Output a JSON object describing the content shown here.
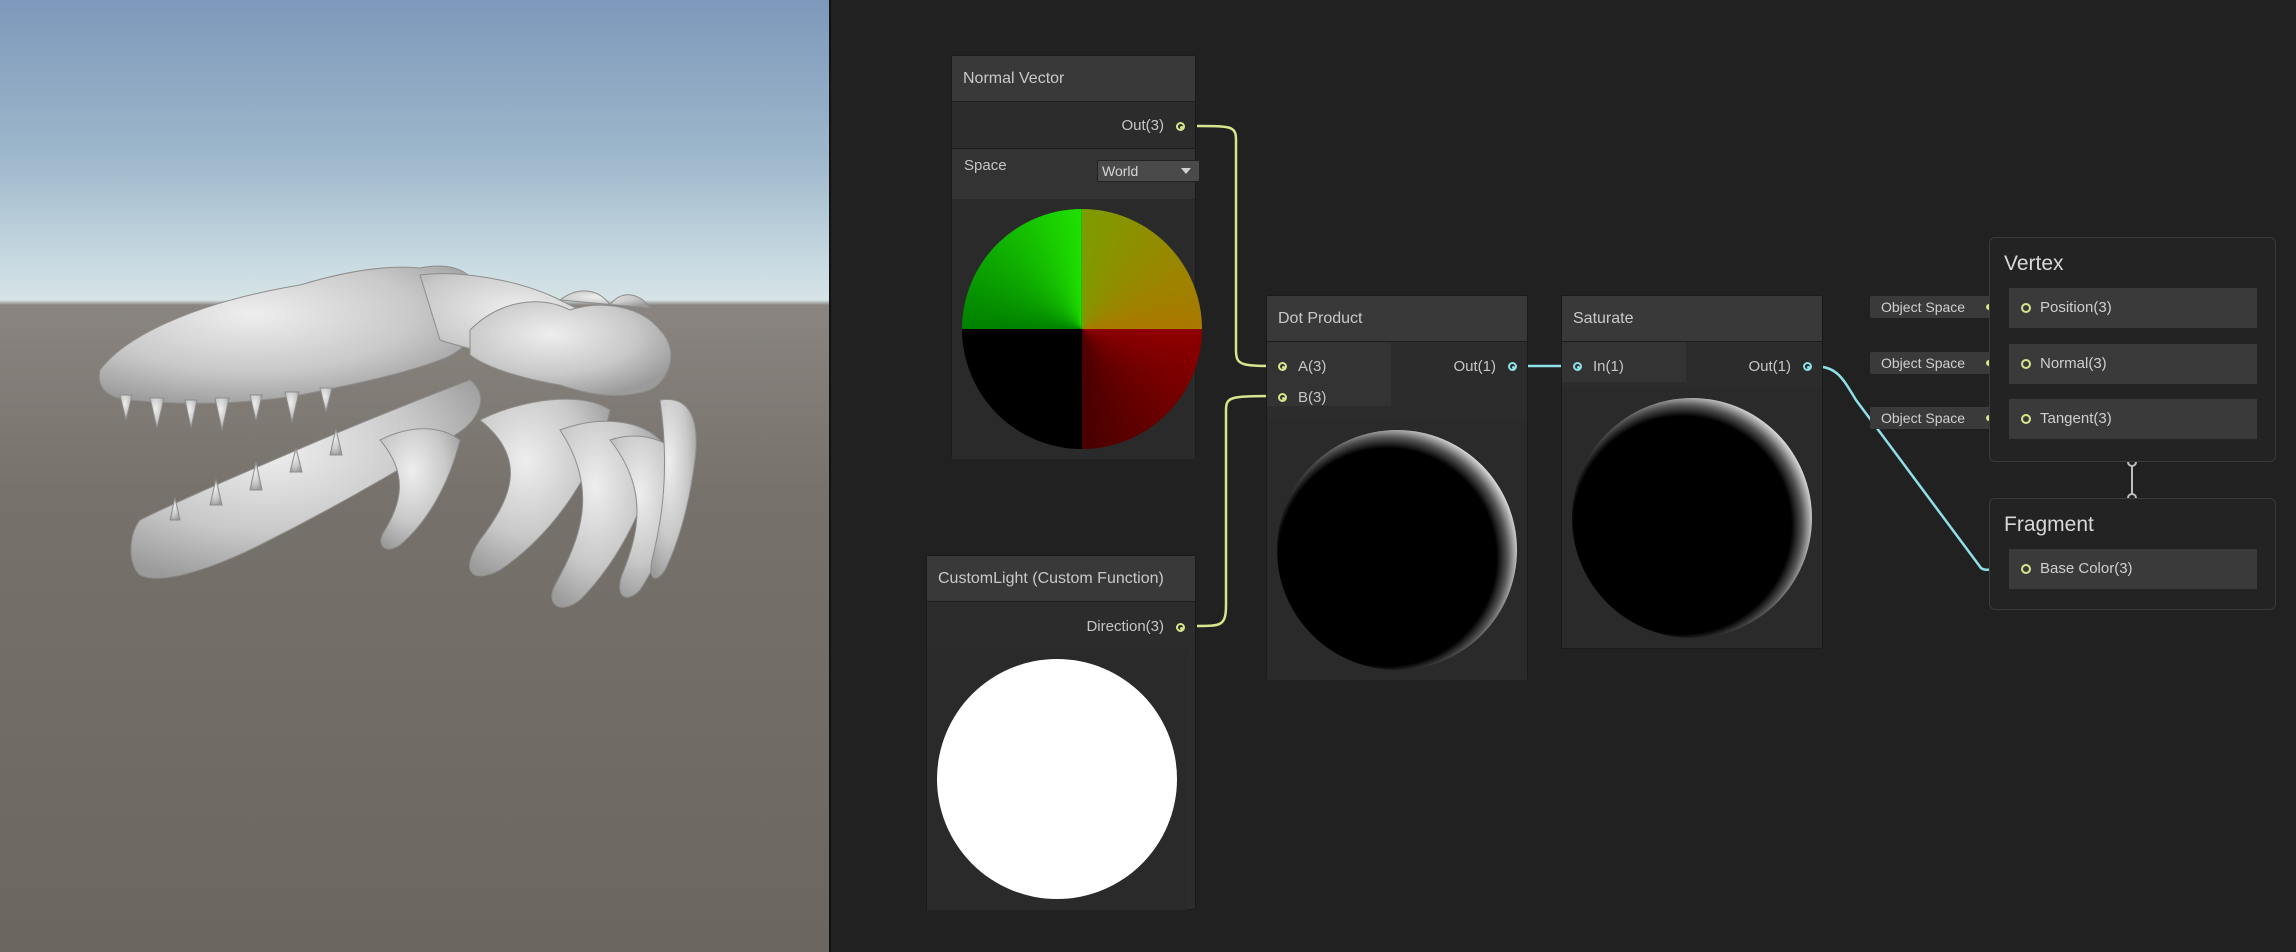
{
  "nodes": {
    "normal_vector": {
      "title": "Normal Vector",
      "out_label": "Out(3)",
      "space_label": "Space",
      "space_value": "World"
    },
    "custom_light": {
      "title": "CustomLight (Custom Function)",
      "out_label": "Direction(3)"
    },
    "dot_product": {
      "title": "Dot Product",
      "in_a": "A(3)",
      "in_b": "B(3)",
      "out_label": "Out(1)"
    },
    "saturate": {
      "title": "Saturate",
      "in_label": "In(1)",
      "out_label": "Out(1)"
    }
  },
  "master": {
    "vertex": {
      "title": "Vertex",
      "slots": [
        "Position(3)",
        "Normal(3)",
        "Tangent(3)"
      ]
    },
    "fragment": {
      "title": "Fragment",
      "slots": [
        "Base Color(3)"
      ]
    },
    "space_pills": [
      "Object Space",
      "Object Space",
      "Object Space"
    ]
  },
  "colors": {
    "wire_vector": "#d8e58c",
    "wire_float": "#8ee0e6",
    "graph_bg": "#212121",
    "node_bg": "#2c2c2c"
  }
}
